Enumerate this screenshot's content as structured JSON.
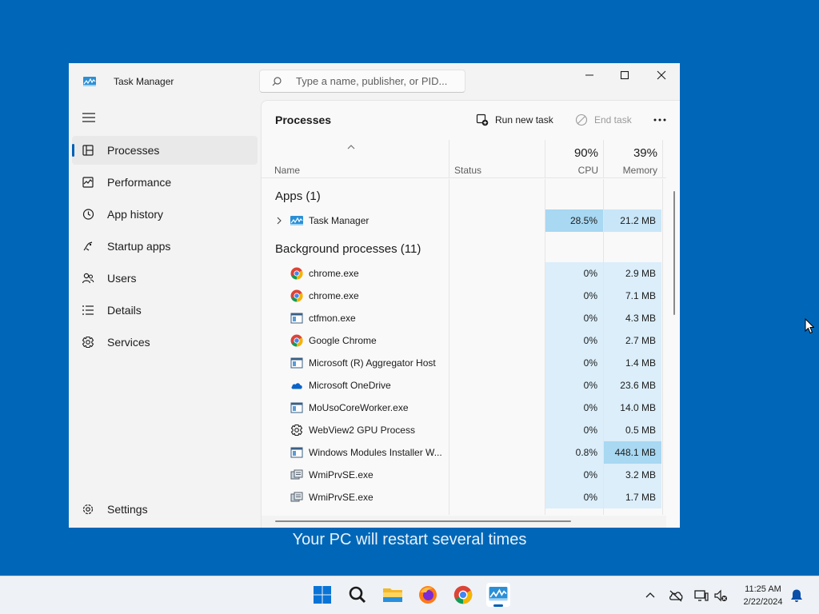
{
  "window": {
    "title": "Task Manager",
    "search_placeholder": "Type a name, publisher, or PID...",
    "minimize_icon": "minimize-icon",
    "maximize_icon": "maximize-icon",
    "close_icon": "close-icon"
  },
  "sidebar": {
    "items": [
      {
        "label": "Processes",
        "icon": "processes-icon",
        "active": true
      },
      {
        "label": "Performance",
        "icon": "performance-icon"
      },
      {
        "label": "App history",
        "icon": "app-history-icon"
      },
      {
        "label": "Startup apps",
        "icon": "startup-apps-icon"
      },
      {
        "label": "Users",
        "icon": "users-icon"
      },
      {
        "label": "Details",
        "icon": "details-icon"
      },
      {
        "label": "Services",
        "icon": "services-icon"
      }
    ],
    "settings_label": "Settings"
  },
  "toolbar": {
    "page_title": "Processes",
    "run_new_task": "Run new task",
    "end_task": "End task"
  },
  "columns": {
    "name": "Name",
    "status": "Status",
    "cpu_pct": "90%",
    "cpu": "CPU",
    "memory_pct": "39%",
    "memory": "Memory"
  },
  "groups": {
    "apps": "Apps (1)",
    "background": "Background processes (11)"
  },
  "apps": [
    {
      "name": "Task Manager",
      "icon": "task-manager-icon",
      "cpu": "28.5%",
      "memory": "21.2 MB"
    }
  ],
  "processes": [
    {
      "name": "chrome.exe",
      "icon": "chrome-icon",
      "cpu": "0%",
      "memory": "2.9 MB"
    },
    {
      "name": "chrome.exe",
      "icon": "chrome-icon",
      "cpu": "0%",
      "memory": "7.1 MB"
    },
    {
      "name": "ctfmon.exe",
      "icon": "window-app-icon",
      "cpu": "0%",
      "memory": "4.3 MB"
    },
    {
      "name": "Google Chrome",
      "icon": "chrome-icon",
      "cpu": "0%",
      "memory": "2.7 MB"
    },
    {
      "name": "Microsoft (R) Aggregator Host",
      "icon": "window-app-icon",
      "cpu": "0%",
      "memory": "1.4 MB"
    },
    {
      "name": "Microsoft OneDrive",
      "icon": "onedrive-icon",
      "cpu": "0%",
      "memory": "23.6 MB"
    },
    {
      "name": "MoUsoCoreWorker.exe",
      "icon": "window-app-icon",
      "cpu": "0%",
      "memory": "14.0 MB"
    },
    {
      "name": "WebView2 GPU Process",
      "icon": "gear-icon",
      "cpu": "0%",
      "memory": "0.5 MB"
    },
    {
      "name": "Windows Modules Installer W...",
      "icon": "window-app-icon",
      "cpu": "0.8%",
      "memory": "448.1 MB"
    },
    {
      "name": "WmiPrvSE.exe",
      "icon": "wmi-icon",
      "cpu": "0%",
      "memory": "3.2 MB"
    },
    {
      "name": "WmiPrvSE.exe",
      "icon": "wmi-icon",
      "cpu": "0%",
      "memory": "1.7 MB"
    }
  ],
  "restart_message": "Your PC will restart several times",
  "taskbar": {
    "apps": [
      "start-icon",
      "search-icon",
      "file-explorer-icon",
      "firefox-icon",
      "chrome-icon",
      "task-manager-icon"
    ],
    "time": "11:25 AM",
    "date": "2/22/2024"
  },
  "colors": {
    "desktop": "#0067b8",
    "accent": "#005fb8",
    "heat_low": "#dbeefa",
    "heat_high": "#a8d8f2"
  }
}
